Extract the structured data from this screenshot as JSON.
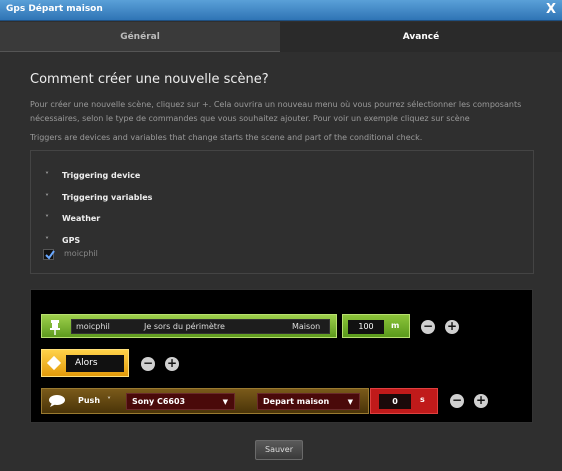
{
  "window": {
    "title": "Gps Départ maison",
    "close_label": "X"
  },
  "tabs": [
    {
      "label": "Général"
    },
    {
      "label": "Avancé"
    }
  ],
  "heading": "Comment créer une nouvelle scène?",
  "description": "Pour créer une nouvelle scène, cliquez sur +. Cela ouvrira un nouveau menu où vous pourrez sélectionner les composants nécessaires, selon le type de commandes que vous souhaitez ajouter. Pour voir un exemple cliquez sur scène",
  "triggers_note": "Triggers are devices and variables that change starts the scene and part of the conditional check.",
  "sections": [
    {
      "label": "Triggering device",
      "chevron": "˅"
    },
    {
      "label": "Triggering variables",
      "chevron": "˅"
    },
    {
      "label": "Weather",
      "chevron": "˅"
    },
    {
      "label": "GPS",
      "chevron": "˅"
    }
  ],
  "gps_checkbox": {
    "label": "moicphil",
    "checked": true
  },
  "scene": {
    "condition": {
      "user": "moicphil",
      "event": "Je sors du périmètre",
      "place": "Maison",
      "distance": "100",
      "unit": "m",
      "color": "#7cb82f"
    },
    "alors": {
      "label": "Alors",
      "color": "#f2b318"
    },
    "action": {
      "type": "Push",
      "chevron": "˅",
      "device": "Sony C6603",
      "scene": "Depart maison",
      "delay": "0",
      "unit": "s",
      "color": "#c01a1a"
    },
    "minus": "−",
    "plus": "+"
  },
  "save_label": "Sauver"
}
